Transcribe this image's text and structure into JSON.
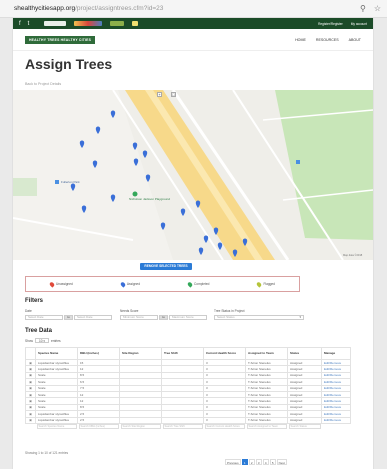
{
  "browser": {
    "url_main": "shealthycitiesapp.org",
    "url_path": "/project/assigntrees.cfm?id=23",
    "icons": [
      "search-icon",
      "star-icon"
    ]
  },
  "topbar": {
    "social": [
      "f",
      "t"
    ],
    "links": [
      "Register/Register",
      "My account"
    ]
  },
  "nav": {
    "brand": "HEALTHY TREES HEALTHY CITIES",
    "items": [
      "HOME",
      "RESOURCES",
      "ABOUT"
    ]
  },
  "page": {
    "title": "Assign Trees",
    "breadcrumb": "Back to Project Details"
  },
  "map": {
    "labels": [
      "Fullerton Park",
      "Nicholson Jackson Playground"
    ],
    "credit": "Map data ©2018"
  },
  "remove_button": "REMOVE SELECTED TREES",
  "legend": [
    {
      "label": "Unassigned",
      "color": "#e04a3a"
    },
    {
      "label": "Assigned",
      "color": "#3a6fd8"
    },
    {
      "label": "Completed",
      "color": "#34a85a"
    },
    {
      "label": "Flagged",
      "color": "#b5c43a"
    }
  ],
  "filters": {
    "heading": "Filters",
    "date": {
      "label": "Date",
      "from": "Select Date",
      "to_label": "to",
      "to": "Select Date"
    },
    "needs": {
      "label": "Needs Score",
      "from": "Minimum Score",
      "to_label": "to",
      "to": "Maximum Score"
    },
    "tree_status": {
      "label": "Tree Status in Project",
      "value": "Select Status"
    }
  },
  "table": {
    "heading": "Tree Data",
    "show_label": "Show",
    "show_value": "10",
    "entries_label": "entries",
    "columns": [
      "",
      "Species Name",
      "DBH (inches)",
      "Site Region",
      "Tree Shift",
      "Current Health Score",
      "Assigned to Team",
      "Status",
      "Manage"
    ],
    "rows": [
      [
        "▣",
        "Liquidambar styraciflua",
        "15",
        "",
        "",
        "3",
        "T-Scion Stenelus",
        "Assigned",
        "Edit/Remove"
      ],
      [
        "▣",
        "Liquidambar styraciflua",
        "12",
        "",
        "",
        "3",
        "T-Scion Stenelus",
        "Assigned",
        "Edit/Remove"
      ],
      [
        "▣",
        "Scale",
        "8.5",
        "",
        "",
        "3",
        "T-Scion Stenelus",
        "Assigned",
        "Edit/Remove"
      ],
      [
        "▣",
        "Scale",
        "6.5",
        "",
        "",
        "3",
        "T-Scion Stenelus",
        "Assigned",
        "Edit/Remove"
      ],
      [
        "▣",
        "Scale",
        "7.5",
        "",
        "",
        "3",
        "T-Scion Stenelus",
        "Assigned",
        "Edit/Remove"
      ],
      [
        "▣",
        "Scale",
        "12",
        "",
        "",
        "3",
        "T-Scion Stenelus",
        "Assigned",
        "Edit/Remove"
      ],
      [
        "▣",
        "Scale",
        "12",
        "",
        "",
        "3",
        "T-Scion Stenelus",
        "Assigned",
        "Edit/Remove"
      ],
      [
        "▣",
        "Scale",
        "8.5",
        "",
        "",
        "3",
        "T-Scion Stenelus",
        "Assigned",
        "Edit/Remove"
      ],
      [
        "▣",
        "Liquidambar styraciflua",
        "2.5",
        "",
        "",
        "3",
        "T-Scion Stenelus",
        "Assigned",
        "Edit/Remove"
      ],
      [
        "▣",
        "Liquidambar styraciflua",
        "2.5",
        "",
        "",
        "3",
        "T-Scion Stenelus",
        "Assigned",
        "Edit/Remove"
      ]
    ],
    "search_placeholders": [
      "Search Species Name",
      "Search DBH (inches)",
      "Search Site Region",
      "Search Tree Shift",
      "Search Current Health Score",
      "Search Assigned to Team",
      "Search Status"
    ],
    "showing": "Showing 1 to 10 of 121 entries"
  },
  "pager": [
    "Previous",
    "1",
    "2",
    "3",
    "4",
    "5",
    "Next"
  ]
}
